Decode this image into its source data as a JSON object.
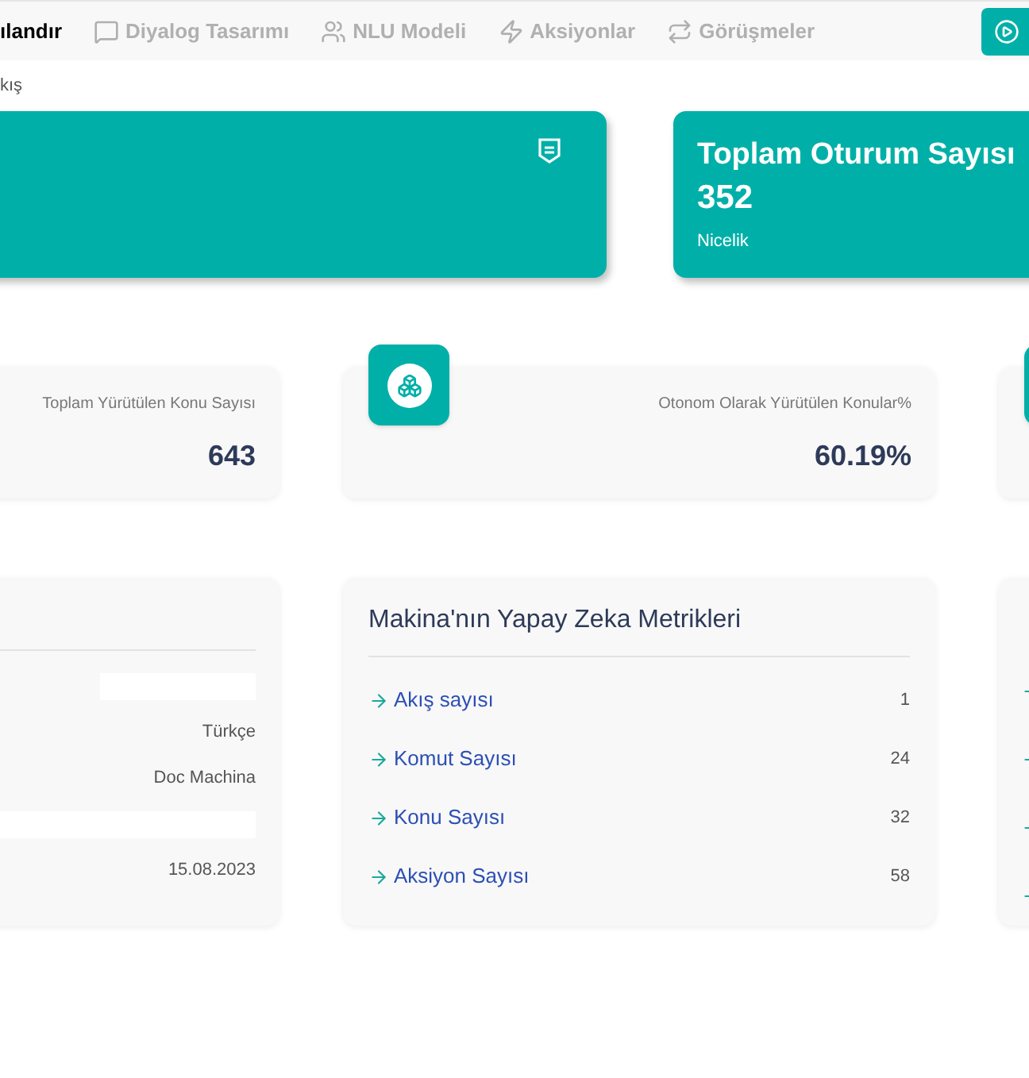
{
  "nav": {
    "tabs": [
      {
        "label": "ılandır",
        "selected": true
      },
      {
        "label": "Diyalog Tasarımı",
        "selected": false
      },
      {
        "label": "NLU Modeli",
        "selected": false
      },
      {
        "label": "Aksiyonlar",
        "selected": false
      },
      {
        "label": "Görüşmeler",
        "selected": false
      }
    ]
  },
  "breadcrumb": "kış",
  "banners": [
    {
      "title": "Toplam Oturum Sayısı",
      "value": "352",
      "caption": "Nicelik"
    }
  ],
  "stats": [
    {
      "label": "Toplam Yürütülen Konu Sayısı",
      "value": "643"
    },
    {
      "label": "Otonom Olarak Yürütülen Konular%",
      "value": "60.19%"
    }
  ],
  "info_card": {
    "rows": [
      {
        "kind": "redacted"
      },
      {
        "kind": "text",
        "value": "Türkçe"
      },
      {
        "kind": "text",
        "value": "Doc Machina"
      },
      {
        "kind": "redacted"
      },
      {
        "kind": "text",
        "value": "15.08.2023"
      }
    ]
  },
  "metrics_card": {
    "title": "Makina'nın Yapay Zeka Metrikleri",
    "items": [
      {
        "label": "Akış sayısı",
        "value": "1"
      },
      {
        "label": "Komut Sayısı",
        "value": "24"
      },
      {
        "label": "Konu Sayısı",
        "value": "32"
      },
      {
        "label": "Aksiyon Sayısı",
        "value": "58"
      }
    ]
  }
}
